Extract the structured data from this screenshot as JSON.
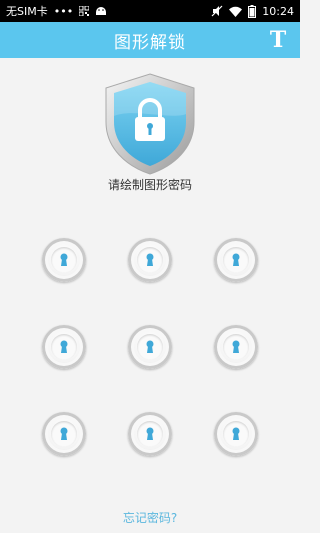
{
  "status_bar": {
    "carrier": "无SIM卡",
    "dots": "•••",
    "time": "10:24",
    "icons": [
      "qr-code-icon",
      "android-icon",
      "mute-icon",
      "wifi-icon",
      "battery-icon"
    ]
  },
  "app_bar": {
    "title": "图形解锁",
    "action_label": "T"
  },
  "main": {
    "prompt": "请绘制图形密码",
    "forgot_link": "忘记密码?"
  },
  "pattern": {
    "rows": 3,
    "cols": 3,
    "dot_icon": "keyhole-icon"
  },
  "colors": {
    "accent": "#5bc6ee",
    "link": "#5bb7de"
  }
}
